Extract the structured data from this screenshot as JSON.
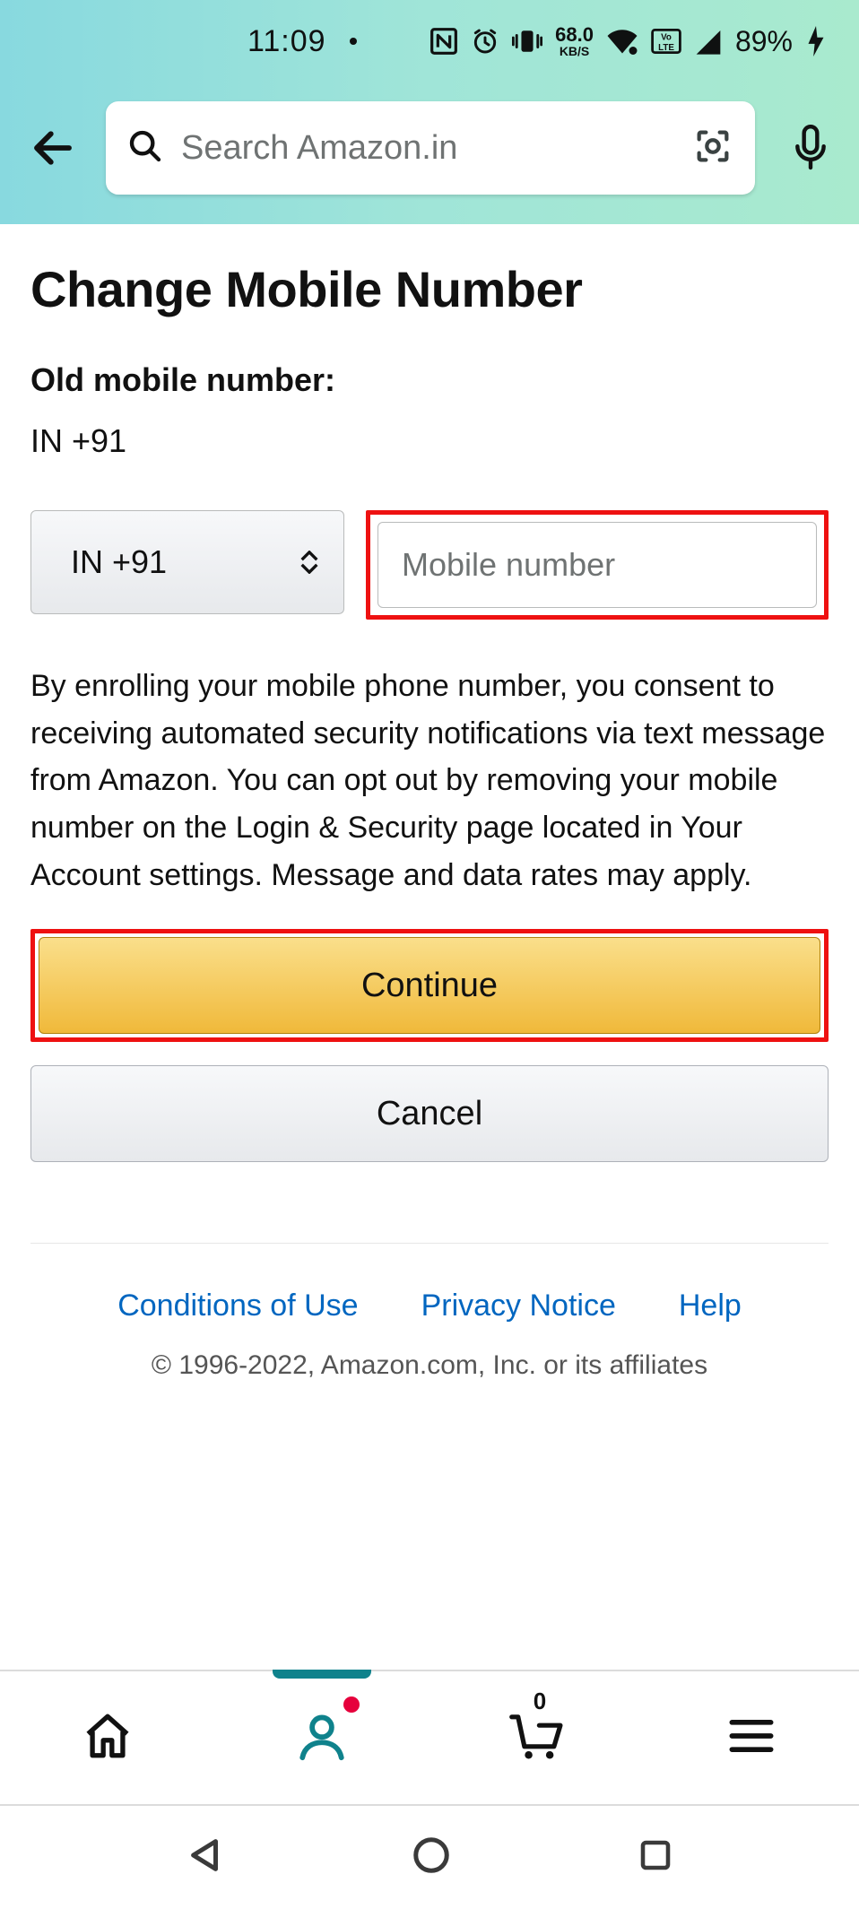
{
  "status": {
    "time": "11:09",
    "net_speed": "68.0",
    "net_unit": "KB/S",
    "battery": "89%"
  },
  "header": {
    "search_placeholder": "Search Amazon.in"
  },
  "page": {
    "title": "Change Mobile Number",
    "old_label": "Old mobile number:",
    "old_value": "IN +91",
    "country_code": "IN +91",
    "mobile_placeholder": "Mobile number",
    "consent": "By enrolling your mobile phone number, you consent to receiving automated security notifications via text message from Amazon. You can opt out by removing your mobile number on the Login & Security page located in Your Account settings. Message and data rates may apply.",
    "continue": "Continue",
    "cancel": "Cancel"
  },
  "footer": {
    "links": [
      "Conditions of Use",
      "Privacy Notice",
      "Help"
    ],
    "copyright": "© 1996-2022, Amazon.com, Inc. or its affiliates"
  },
  "bottomnav": {
    "cart_count": "0"
  }
}
